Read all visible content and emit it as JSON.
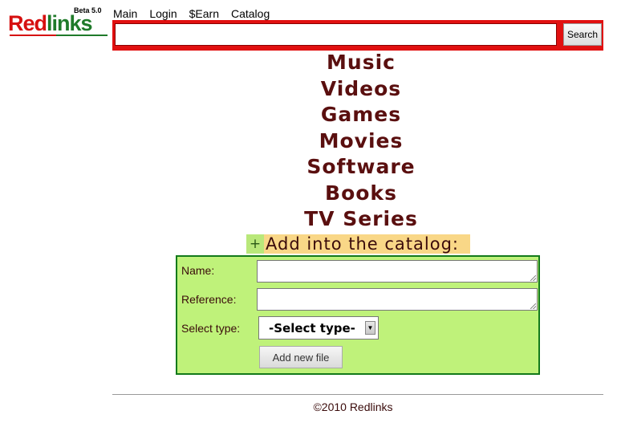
{
  "logo": {
    "text_red": "Red",
    "text_green": "links",
    "beta": "Beta 5.0"
  },
  "nav": {
    "items": [
      "Main",
      "Login",
      "$Earn",
      "Catalog"
    ]
  },
  "search": {
    "value": "",
    "placeholder": "",
    "button_label": "Search"
  },
  "categories": [
    "Music",
    "Videos",
    "Games",
    "Movies",
    "Software",
    "Books",
    "TV Series"
  ],
  "add_section": {
    "toggle_symbol": "+",
    "title": "Add into the catalog:",
    "name_label": "Name:",
    "name_value": "",
    "reference_label": "Reference:",
    "reference_value": "",
    "type_label": "Select type:",
    "type_selected": "-Select type-",
    "submit_label": "Add new file"
  },
  "footer": {
    "text": "©2010 Redlinks"
  },
  "colors": {
    "search_bar": "#e11010",
    "category_text": "#5a0f0f",
    "form_panel_bg": "#bff27a",
    "form_panel_border": "#137a1b",
    "add_header_bg": "#f9d787"
  }
}
